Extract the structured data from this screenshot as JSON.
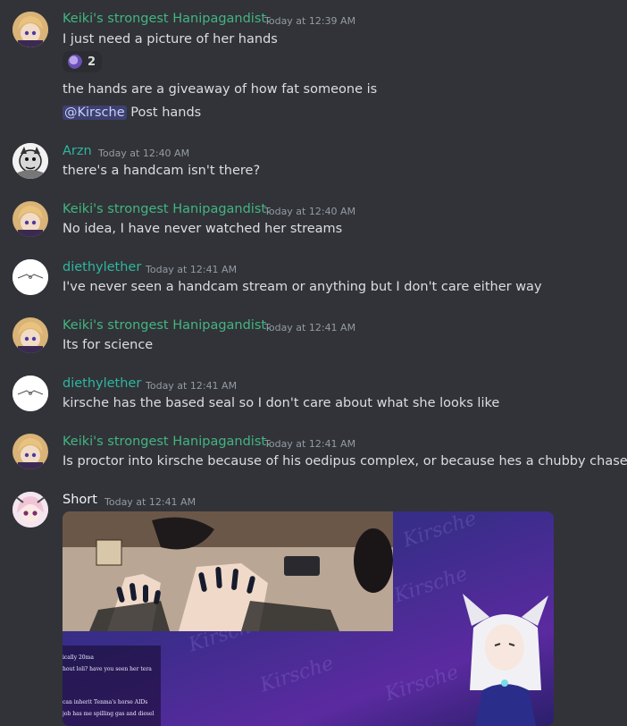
{
  "messages": [
    {
      "username": "Keiki's strongest Hanipagandist.",
      "timestamp": "Today at 12:39 AM",
      "lines": [
        "I just need a picture of her hands"
      ],
      "reaction": {
        "emoji": "purple-sticker-emoji",
        "count": "2"
      },
      "extra_lines": [
        "the hands are a giveaway of how fat someone is"
      ],
      "mention": "@Kirsche",
      "mention_rest": " Post hands"
    },
    {
      "username": "Arzn",
      "timestamp": "Today at 12:40 AM",
      "lines": [
        "there's a handcam isn't there?"
      ]
    },
    {
      "username": "Keiki's strongest Hanipagandist.",
      "timestamp": "Today at 12:40 AM",
      "lines": [
        "No idea, I have never watched her streams"
      ]
    },
    {
      "username": "diethylether",
      "timestamp": "Today at 12:41 AM",
      "lines": [
        "I've never seen a handcam stream or anything but I don't care either way"
      ]
    },
    {
      "username": "Keiki's strongest Hanipagandist.",
      "timestamp": "Today at 12:41 AM",
      "lines": [
        "Its for science"
      ]
    },
    {
      "username": "diethylether",
      "timestamp": "Today at 12:41 AM",
      "lines": [
        "kirsche has the based seal so I don't care about what she looks like"
      ]
    },
    {
      "username": "Keiki's strongest Hanipagandist.",
      "timestamp": "Today at 12:41 AM",
      "lines": [
        "Is proctor into kirsche because of his oedipus complex, or because hes a chubby chaser"
      ]
    },
    {
      "username": "Short",
      "timestamp": "Today at 12:41 AM",
      "attachment": {
        "watermark": "Kirsche",
        "chat_lines": [
          "ically 20ma",
          "hout loli? have you seen her tera",
          "can inherit Tenma's horse AIDs",
          "job has me spilling gas and diesel"
        ]
      }
    }
  ],
  "colors": {
    "background": "#313338",
    "username_green": "#43b581",
    "username_teal": "#2fb69e",
    "timestamp": "#949ba4",
    "mention_bg": "#3c4270"
  }
}
